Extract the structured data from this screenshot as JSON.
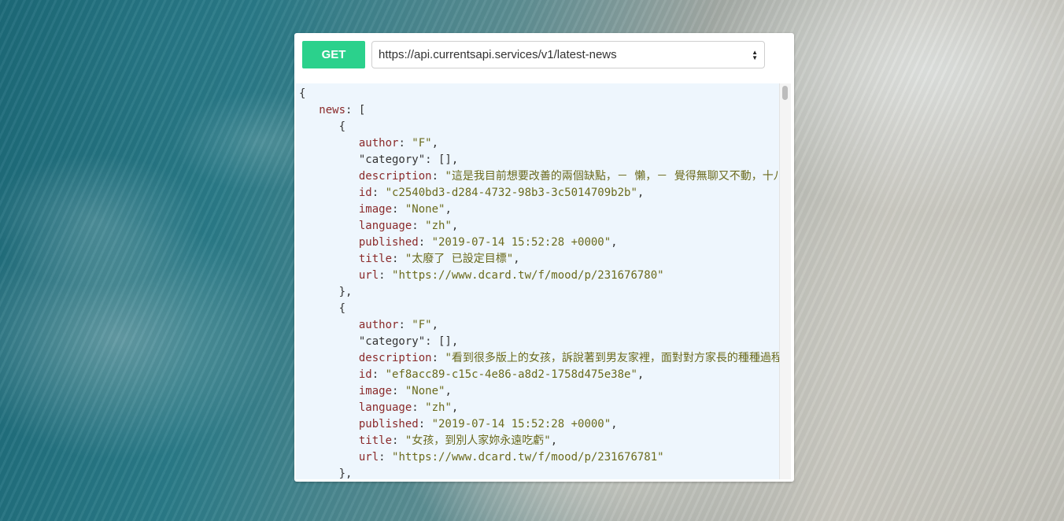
{
  "request": {
    "method_label": "GET",
    "url": "https://api.currentsapi.services/v1/latest-news"
  },
  "response": {
    "lines": [
      [
        {
          "t": "p",
          "v": "{"
        }
      ],
      [
        {
          "t": "p",
          "v": "   "
        },
        {
          "t": "k",
          "v": "news"
        },
        {
          "t": "p",
          "v": ": ["
        }
      ],
      [
        {
          "t": "p",
          "v": "      {"
        }
      ],
      [
        {
          "t": "p",
          "v": "         "
        },
        {
          "t": "k",
          "v": "author"
        },
        {
          "t": "p",
          "v": ": "
        },
        {
          "t": "s",
          "v": "\"F\""
        },
        {
          "t": "p",
          "v": ","
        }
      ],
      [
        {
          "t": "p",
          "v": "         \"category\": [],"
        }
      ],
      [
        {
          "t": "p",
          "v": "         "
        },
        {
          "t": "k",
          "v": "description"
        },
        {
          "t": "p",
          "v": ": "
        },
        {
          "t": "s",
          "v": "\"這是我目前想要改善的兩個缺點，－ 懶，－ 覺得無聊又不動，十八年"
        }
      ],
      [
        {
          "t": "p",
          "v": "         "
        },
        {
          "t": "k",
          "v": "id"
        },
        {
          "t": "p",
          "v": ": "
        },
        {
          "t": "s",
          "v": "\"c2540bd3-d284-4732-98b3-3c5014709b2b\""
        },
        {
          "t": "p",
          "v": ","
        }
      ],
      [
        {
          "t": "p",
          "v": "         "
        },
        {
          "t": "k",
          "v": "image"
        },
        {
          "t": "p",
          "v": ": "
        },
        {
          "t": "s",
          "v": "\"None\""
        },
        {
          "t": "p",
          "v": ","
        }
      ],
      [
        {
          "t": "p",
          "v": "         "
        },
        {
          "t": "k",
          "v": "language"
        },
        {
          "t": "p",
          "v": ": "
        },
        {
          "t": "s",
          "v": "\"zh\""
        },
        {
          "t": "p",
          "v": ","
        }
      ],
      [
        {
          "t": "p",
          "v": "         "
        },
        {
          "t": "k",
          "v": "published"
        },
        {
          "t": "p",
          "v": ": "
        },
        {
          "t": "s",
          "v": "\"2019-07-14 15:52:28 +0000\""
        },
        {
          "t": "p",
          "v": ","
        }
      ],
      [
        {
          "t": "p",
          "v": "         "
        },
        {
          "t": "k",
          "v": "title"
        },
        {
          "t": "p",
          "v": ": "
        },
        {
          "t": "s",
          "v": "\"太廢了 已設定目標\""
        },
        {
          "t": "p",
          "v": ","
        }
      ],
      [
        {
          "t": "p",
          "v": "         "
        },
        {
          "t": "k",
          "v": "url"
        },
        {
          "t": "p",
          "v": ": "
        },
        {
          "t": "s",
          "v": "\"https://www.dcard.tw/f/mood/p/231676780\""
        }
      ],
      [
        {
          "t": "p",
          "v": "      },"
        }
      ],
      [
        {
          "t": "p",
          "v": "      {"
        }
      ],
      [
        {
          "t": "p",
          "v": "         "
        },
        {
          "t": "k",
          "v": "author"
        },
        {
          "t": "p",
          "v": ": "
        },
        {
          "t": "s",
          "v": "\"F\""
        },
        {
          "t": "p",
          "v": ","
        }
      ],
      [
        {
          "t": "p",
          "v": "         \"category\": [],"
        }
      ],
      [
        {
          "t": "p",
          "v": "         "
        },
        {
          "t": "k",
          "v": "description"
        },
        {
          "t": "p",
          "v": ": "
        },
        {
          "t": "s",
          "v": "\"看到很多版上的女孩，訴說著到男友家裡，面對對方家長的種種過程"
        }
      ],
      [
        {
          "t": "p",
          "v": "         "
        },
        {
          "t": "k",
          "v": "id"
        },
        {
          "t": "p",
          "v": ": "
        },
        {
          "t": "s",
          "v": "\"ef8acc89-c15c-4e86-a8d2-1758d475e38e\""
        },
        {
          "t": "p",
          "v": ","
        }
      ],
      [
        {
          "t": "p",
          "v": "         "
        },
        {
          "t": "k",
          "v": "image"
        },
        {
          "t": "p",
          "v": ": "
        },
        {
          "t": "s",
          "v": "\"None\""
        },
        {
          "t": "p",
          "v": ","
        }
      ],
      [
        {
          "t": "p",
          "v": "         "
        },
        {
          "t": "k",
          "v": "language"
        },
        {
          "t": "p",
          "v": ": "
        },
        {
          "t": "s",
          "v": "\"zh\""
        },
        {
          "t": "p",
          "v": ","
        }
      ],
      [
        {
          "t": "p",
          "v": "         "
        },
        {
          "t": "k",
          "v": "published"
        },
        {
          "t": "p",
          "v": ": "
        },
        {
          "t": "s",
          "v": "\"2019-07-14 15:52:28 +0000\""
        },
        {
          "t": "p",
          "v": ","
        }
      ],
      [
        {
          "t": "p",
          "v": "         "
        },
        {
          "t": "k",
          "v": "title"
        },
        {
          "t": "p",
          "v": ": "
        },
        {
          "t": "s",
          "v": "\"女孩，到別人家妳永遠吃虧\""
        },
        {
          "t": "p",
          "v": ","
        }
      ],
      [
        {
          "t": "p",
          "v": "         "
        },
        {
          "t": "k",
          "v": "url"
        },
        {
          "t": "p",
          "v": ": "
        },
        {
          "t": "s",
          "v": "\"https://www.dcard.tw/f/mood/p/231676781\""
        }
      ],
      [
        {
          "t": "p",
          "v": "      },"
        }
      ]
    ]
  },
  "colors": {
    "get_button": "#2bd18c",
    "code_background": "#eef6fd",
    "json_key": "#8a2a2a",
    "json_string": "#6b6a1c"
  },
  "icons": {
    "select_arrows": "up-down-arrows-icon"
  }
}
